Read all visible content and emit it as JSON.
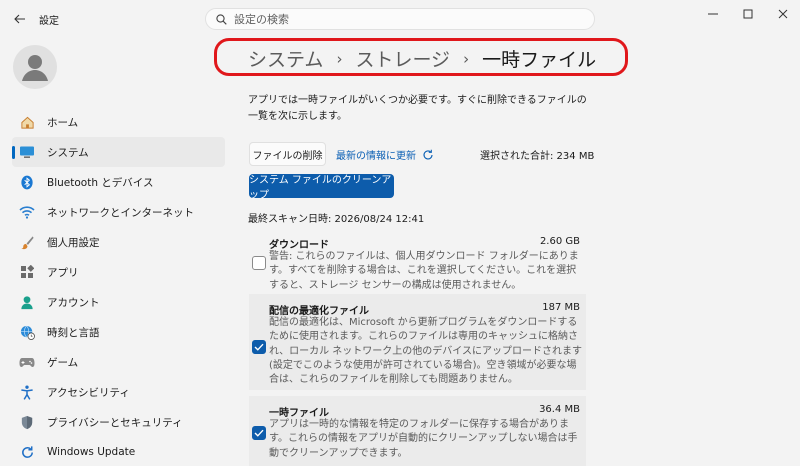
{
  "window": {
    "title": "設定"
  },
  "search": {
    "placeholder": "設定の検索"
  },
  "sidebar": {
    "items": [
      {
        "label": "ホーム",
        "icon": "home-icon",
        "active": false
      },
      {
        "label": "システム",
        "icon": "monitor-icon",
        "active": true
      },
      {
        "label": "Bluetooth とデバイス",
        "icon": "bluetooth-icon",
        "active": false
      },
      {
        "label": "ネットワークとインターネット",
        "icon": "wifi-icon",
        "active": false
      },
      {
        "label": "個人用設定",
        "icon": "brush-icon",
        "active": false
      },
      {
        "label": "アプリ",
        "icon": "apps-icon",
        "active": false
      },
      {
        "label": "アカウント",
        "icon": "account-icon",
        "active": false
      },
      {
        "label": "時刻と言語",
        "icon": "globe-clock-icon",
        "active": false
      },
      {
        "label": "ゲーム",
        "icon": "gamepad-icon",
        "active": false
      },
      {
        "label": "アクセシビリティ",
        "icon": "accessibility-icon",
        "active": false
      },
      {
        "label": "プライバシーとセキュリティ",
        "icon": "shield-icon",
        "active": false
      },
      {
        "label": "Windows Update",
        "icon": "update-icon",
        "active": false
      }
    ]
  },
  "breadcrumb": {
    "items": [
      "システム",
      "ストレージ"
    ],
    "current": "一時ファイル",
    "separator": "›"
  },
  "main": {
    "description": "アプリでは一時ファイルがいくつか必要です。すぐに削除できるファイルの一覧を次に示します。",
    "delete_button": "ファイルの削除",
    "refresh_link": "最新の情報に更新",
    "total_selected": "選択された合計: 234 MB",
    "cleanup_button": "システム ファイルのクリーンアップ",
    "last_scan": "最終スキャン日時: 2026/08/24 12:41"
  },
  "files": [
    {
      "name": "ダウンロード",
      "size": "2.60 GB",
      "checked": false,
      "description": "警告: これらのファイルは、個人用ダウンロード フォルダーにあります。すべてを削除する場合は、これを選択してください。これを選択すると、ストレージ センサーの構成は使用されません。"
    },
    {
      "name": "配信の最適化ファイル",
      "size": "187 MB",
      "checked": true,
      "description": "配信の最適化は、Microsoft から更新プログラムをダウンロードするために使用されます。これらのファイルは専用のキャッシュに格納され、ローカル ネットワーク上の他のデバイスにアップロードされます (設定でこのような使用が許可されている場合)。空き領域が必要な場合は、これらのファイルを削除しても問題ありません。"
    },
    {
      "name": "一時ファイル",
      "size": "36.4 MB",
      "checked": true,
      "description": "アプリは一時的な情報を特定のフォルダーに保存する場合があります。これらの情報をアプリが自動的にクリーンアップしない場合は手動でクリーンアップできます。"
    }
  ],
  "colors": {
    "accent": "#0d5cab",
    "link": "#0a5fb4",
    "annotation_ring": "#e0171b"
  }
}
